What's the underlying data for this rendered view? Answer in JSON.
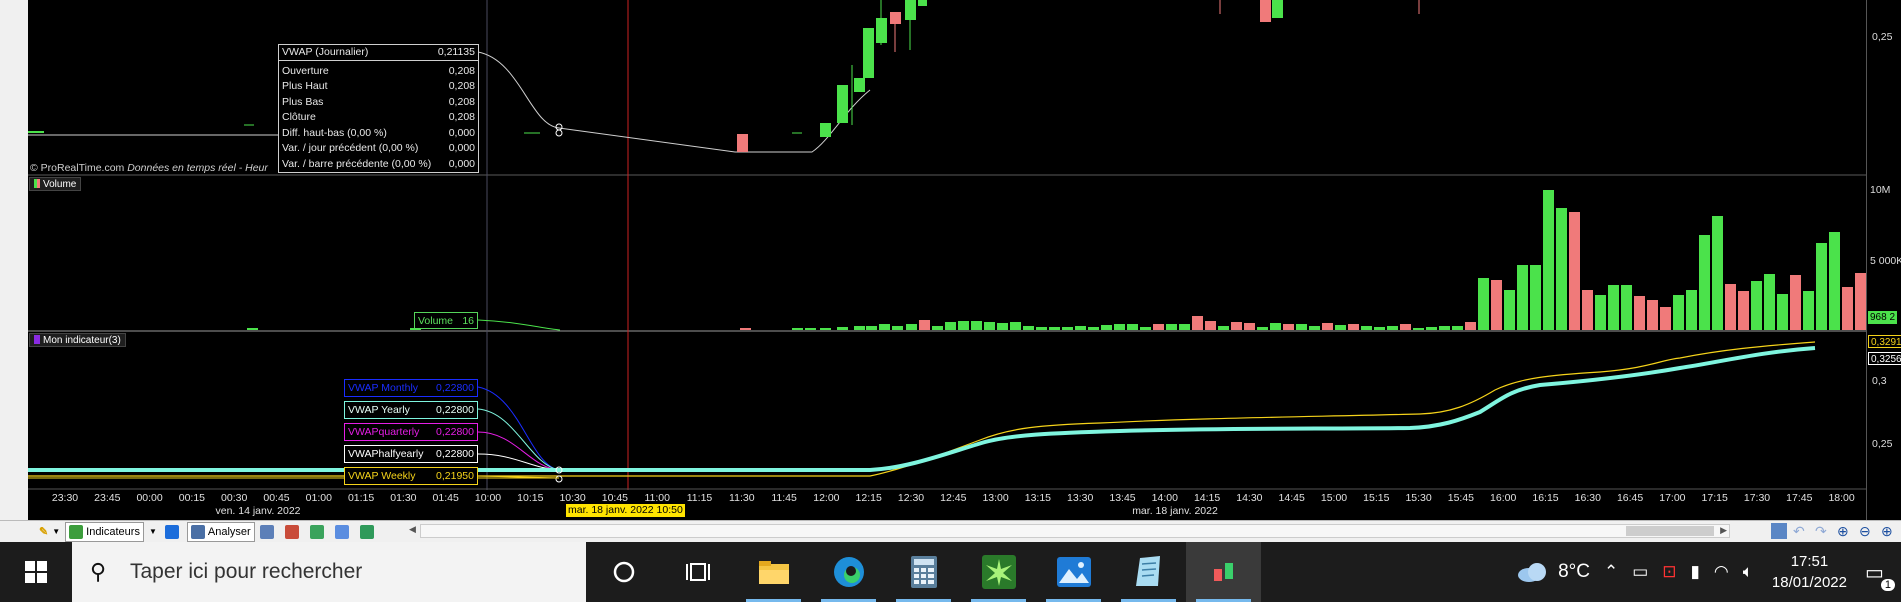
{
  "chart": {
    "copyright": "© ProRealTime.com",
    "copyright_note": "Données en temps réel - Heur",
    "vwap_box": {
      "title": "VWAP (Journalier)",
      "title_value": "0,21135",
      "rows": [
        {
          "label": "Ouverture",
          "value": "0,208"
        },
        {
          "label": "Plus Haut",
          "value": "0,208"
        },
        {
          "label": "Plus Bas",
          "value": "0,208"
        },
        {
          "label": "Clôture",
          "value": "0,208"
        },
        {
          "label": "Diff. haut-bas (0,00 %)",
          "value": "0,000"
        },
        {
          "label": "Var. / jour précédent (0,00 %)",
          "value": "0,000"
        },
        {
          "label": "Var. / barre précédente (0,00 %)",
          "value": "0,000"
        }
      ]
    },
    "volume_panel": {
      "title": "Volume",
      "tag_label": "Volume",
      "tag_value": "16"
    },
    "indicator_panel": {
      "title": "Mon indicateur(3)",
      "labels": [
        {
          "name": "VWAP Monthly",
          "value": "0,22800",
          "color": "#1a2dff"
        },
        {
          "name": "VWAP Yearly",
          "value": "0,22800",
          "color": "#7ff5df"
        },
        {
          "name": "VWAPquarterly",
          "value": "0,22800",
          "color": "#e61ee6"
        },
        {
          "name": "VWAPhalfyearly",
          "value": "0,22800",
          "color": "#ffffff"
        },
        {
          "name": "VWAP Weekly",
          "value": "0,21950",
          "color": "#f5d31a"
        }
      ]
    },
    "right_axis": {
      "price_label": "0,25",
      "vol_10m": "10M",
      "vol_5m": "5 000K",
      "vol_chip": "968 2",
      "ind_03": "0,3",
      "ind_025": "0,25",
      "ind_chip_a": "0,3291",
      "ind_chip_b": "0,3256"
    },
    "time_axis": {
      "ticks": [
        "23:30",
        "23:45",
        "00:00",
        "00:15",
        "00:30",
        "00:45",
        "01:00",
        "01:15",
        "01:30",
        "01:45",
        "10:00",
        "10:15",
        "10:30",
        "10:45",
        "11:00",
        "11:15",
        "11:30",
        "11:45",
        "12:00",
        "12:15",
        "12:30",
        "12:45",
        "13:00",
        "13:15",
        "13:30",
        "13:45",
        "14:00",
        "14:15",
        "14:30",
        "14:45",
        "15:00",
        "15:15",
        "15:30",
        "15:45",
        "16:00",
        "16:15",
        "16:30",
        "16:45",
        "17:00",
        "17:15",
        "17:30",
        "17:45",
        "18:00"
      ],
      "date_left": "ven. 14 janv. 2022",
      "date_right": "mar. 18 janv. 2022",
      "cursor_date": "mar. 18 janv. 2022 10:50"
    }
  },
  "app_toolbar": {
    "indicators_label": "Indicateurs",
    "analyse_label": "Analyser"
  },
  "taskbar": {
    "search_placeholder": "Taper ici pour rechercher",
    "weather_temp": "8°C",
    "time": "17:51",
    "date": "18/01/2022",
    "notification_count": "1",
    "apps": [
      "cortana-icon",
      "task-view-icon",
      "file-explorer-icon",
      "edge-icon",
      "calculator-icon",
      "greenshot-icon",
      "photos-icon",
      "notepad-icon",
      "prorealtime-icon"
    ]
  }
}
